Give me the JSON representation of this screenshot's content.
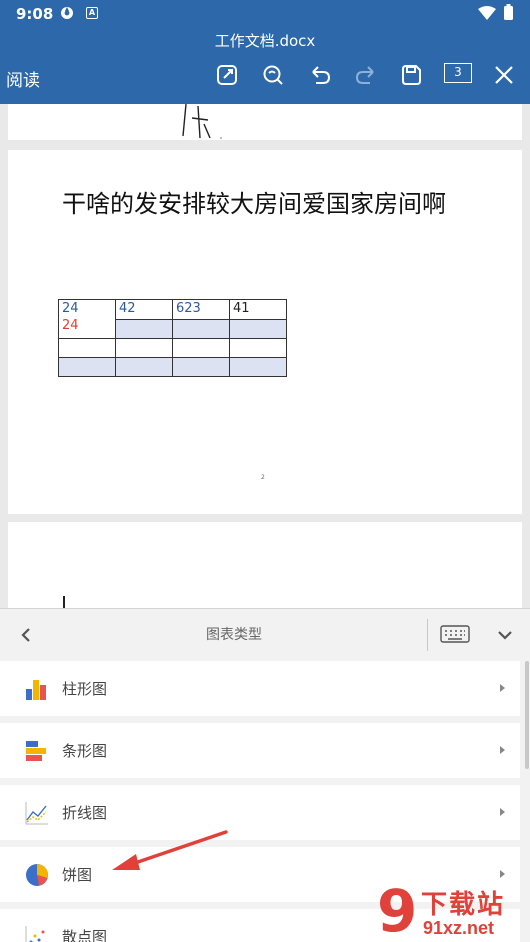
{
  "status_bar": {
    "time": "9:08",
    "badge": "A"
  },
  "app_bar": {
    "doc_title": "工作文档.docx",
    "read_label": "阅读",
    "page_count": "3",
    "icons": [
      "edit-icon",
      "search-icon",
      "undo-icon",
      "redo-icon",
      "save-icon",
      "page-count-icon",
      "close-icon"
    ]
  },
  "document": {
    "heading": "干啥的发安排较大房间爱国家房间啊",
    "table": [
      [
        {
          "v": "24",
          "v2": "24"
        },
        {
          "v": "42"
        },
        {
          "v": "623"
        },
        {
          "v": "41"
        }
      ],
      [
        {
          "v": ""
        },
        {
          "v": ""
        },
        {
          "v": ""
        },
        {
          "v": ""
        }
      ],
      [
        {
          "v": ""
        },
        {
          "v": ""
        },
        {
          "v": ""
        },
        {
          "v": ""
        }
      ]
    ],
    "page_number": "2"
  },
  "panel": {
    "title": "图表类型",
    "items": [
      {
        "label": "柱形图",
        "icon": "column-chart-icon"
      },
      {
        "label": "条形图",
        "icon": "bar-chart-icon"
      },
      {
        "label": "折线图",
        "icon": "line-chart-icon"
      },
      {
        "label": "饼图",
        "icon": "pie-chart-icon"
      },
      {
        "label": "散点图",
        "icon": "scatter-chart-icon"
      }
    ]
  },
  "watermark": {
    "brand": "下载站",
    "url": "91xz.net",
    "digit": "9"
  },
  "colors": {
    "primary": "#2c68aa",
    "annotation": "#e0413a",
    "selection": "#dde2f2"
  }
}
